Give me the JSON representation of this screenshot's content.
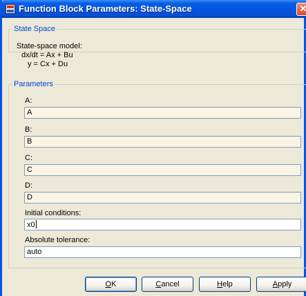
{
  "window": {
    "title": "Function Block Parameters: State-Space",
    "close_glyph": "✕"
  },
  "description_group": {
    "legend": "State Space",
    "lines": [
      "State-space model:",
      "dx/dt = Ax + Bu",
      "y = Cx + Du"
    ]
  },
  "parameters_group": {
    "legend": "Parameters",
    "fields": [
      {
        "label": "A:",
        "value": "A"
      },
      {
        "label": "B:",
        "value": "B"
      },
      {
        "label": "C:",
        "value": "C"
      },
      {
        "label": "D:",
        "value": "D"
      },
      {
        "label": "Initial conditions:",
        "value": "x0"
      },
      {
        "label": "Absolute tolerance:",
        "value": "auto"
      }
    ]
  },
  "buttons": {
    "ok": {
      "mnemonic": "O",
      "rest": "K"
    },
    "cancel": {
      "mnemonic": "C",
      "rest": "ancel"
    },
    "help": {
      "mnemonic": "H",
      "rest": "elp"
    },
    "apply": {
      "mnemonic": "A",
      "rest": "pply"
    }
  },
  "colors": {
    "titlebar": "#0055E5",
    "dialog_bg": "#ECE9D8",
    "legend_text": "#0046D5",
    "edit_field_bg": "#FBF3E4",
    "input_border": "#7F9DB9"
  }
}
